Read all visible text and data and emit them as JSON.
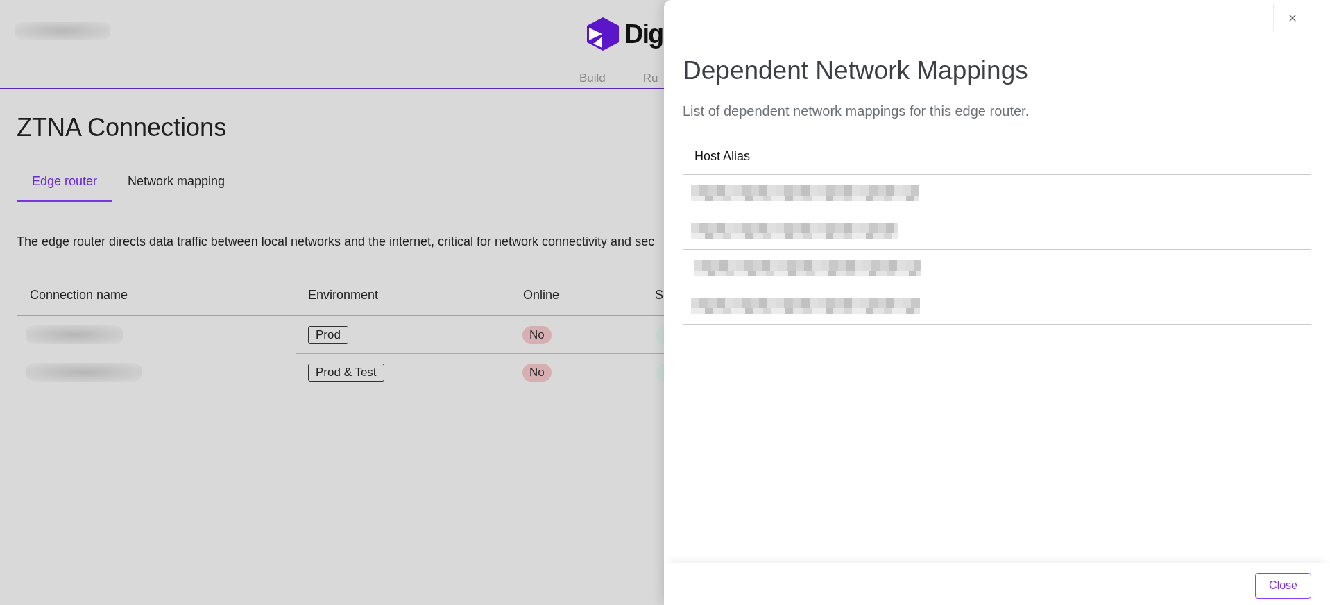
{
  "header": {
    "logo_text": "Dig",
    "nav": [
      {
        "label": "Build"
      },
      {
        "label": "Ru"
      }
    ]
  },
  "page": {
    "title": "ZTNA Connections",
    "tabs": [
      {
        "label": "Edge router",
        "selected": true
      },
      {
        "label": "Network mapping",
        "selected": false
      }
    ],
    "description": "The edge router directs data traffic between local networks and the internet, critical for network connectivity and sec",
    "table": {
      "columns": [
        "Connection name",
        "Environment",
        "Online",
        "S"
      ],
      "rows": [
        {
          "connection_name": {
            "kind": "blurred"
          },
          "environment": "Prod",
          "online": {
            "label": "No",
            "on": false
          }
        },
        {
          "connection_name": {
            "kind": "blurred"
          },
          "environment": "Prod & Test",
          "online": {
            "label": "No",
            "on": false
          }
        }
      ]
    }
  },
  "drawer": {
    "title": "Dependent Network Mappings",
    "subtitle": "List of dependent network mappings for this edge router.",
    "table": {
      "columns": [
        "Host Alias"
      ],
      "rows": [
        {
          "host_alias": {
            "kind": "pixelated"
          }
        },
        {
          "host_alias": {
            "kind": "pixelated"
          }
        },
        {
          "host_alias": {
            "kind": "pixelated"
          }
        },
        {
          "host_alias": {
            "kind": "pixelated"
          }
        }
      ]
    },
    "footer_buttons": [
      "Close"
    ]
  }
}
